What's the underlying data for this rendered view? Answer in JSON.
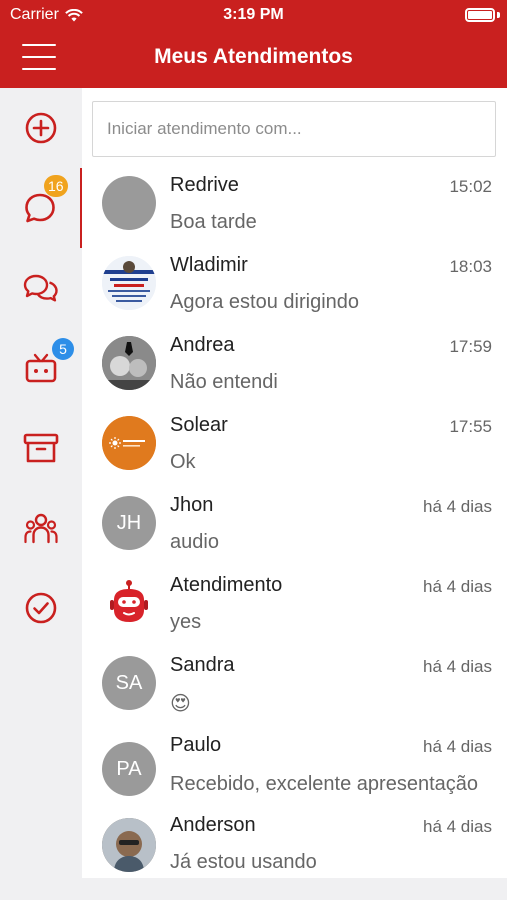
{
  "status_bar": {
    "carrier": "Carrier",
    "time": "3:19 PM"
  },
  "header": {
    "title": "Meus Atendimentos"
  },
  "sidebar": {
    "badges": {
      "chats": "16",
      "tv": "5"
    },
    "colors": {
      "accent": "#c9201f",
      "badge_orange": "#f0a31e",
      "badge_blue": "#2d8ee8"
    }
  },
  "search": {
    "placeholder": "Iniciar atendimento com..."
  },
  "chats": [
    {
      "name": "Redrive",
      "time": "15:02",
      "message": "Boa tarde",
      "initials": ""
    },
    {
      "name": "Wladimir",
      "time": "18:03",
      "message": "Agora estou dirigindo",
      "initials": ""
    },
    {
      "name": "Andrea",
      "time": "17:59",
      "message": "Não entendi",
      "initials": ""
    },
    {
      "name": "Solear",
      "time": "17:55",
      "message": "Ok",
      "initials": ""
    },
    {
      "name": "Jhon",
      "time": "há 4 dias",
      "message": "audio",
      "initials": "JH"
    },
    {
      "name": "Atendimento",
      "time": "há 4 dias",
      "message": "yes",
      "initials": ""
    },
    {
      "name": "Sandra",
      "time": "há 4 dias",
      "message": "😍",
      "initials": "SA"
    },
    {
      "name": "Paulo",
      "time": "há 4 dias",
      "message": "Recebido, excelente apresentação",
      "initials": "PA"
    },
    {
      "name": "Anderson",
      "time": "há 4 dias",
      "message": "Já estou usando",
      "initials": ""
    }
  ]
}
